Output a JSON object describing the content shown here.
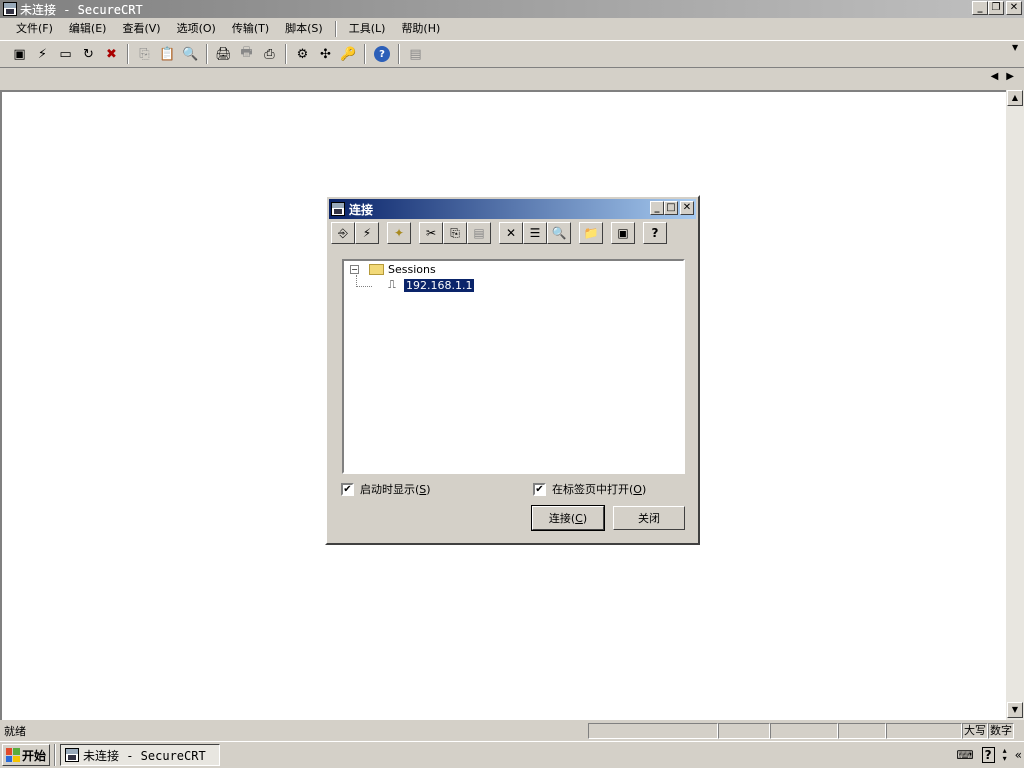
{
  "window": {
    "title": "未连接 - SecureCRT",
    "minimize": "_",
    "restore": "❐",
    "close": "✕"
  },
  "menu": [
    "文件(F)",
    "编辑(E)",
    "查看(V)",
    "选项(O)",
    "传输(T)",
    "脚本(S)",
    "工具(L)",
    "帮助(H)"
  ],
  "toolbar_icons": [
    {
      "name": "connect-icon",
      "glyph": "▣"
    },
    {
      "name": "quick-connect-icon",
      "glyph": "⚡"
    },
    {
      "name": "connect-tab-icon",
      "glyph": "▭"
    },
    {
      "name": "reconnect-icon",
      "glyph": "↻"
    },
    {
      "name": "disconnect-icon",
      "glyph": "✖"
    },
    {
      "name": "copy-icon",
      "glyph": "⎘"
    },
    {
      "name": "paste-icon",
      "glyph": "📋"
    },
    {
      "name": "find-icon",
      "glyph": "🔍"
    },
    {
      "name": "print-icon",
      "glyph": "🖨"
    },
    {
      "name": "print-selection-icon",
      "glyph": "🖶"
    },
    {
      "name": "print-setup-icon",
      "glyph": "⎙"
    },
    {
      "name": "session-options-icon",
      "glyph": "⚙"
    },
    {
      "name": "global-options-icon",
      "glyph": "✣"
    },
    {
      "name": "keymap-icon",
      "glyph": "🔑"
    },
    {
      "name": "help-icon",
      "glyph": "?"
    },
    {
      "name": "log-icon",
      "glyph": "▤"
    }
  ],
  "status": {
    "text": "就绪",
    "caps": "大写",
    "num": "数字"
  },
  "taskbar": {
    "start": "开始",
    "task": "未连接 - SecureCRT"
  },
  "dialog": {
    "title": "连接",
    "toolbar_icons": [
      {
        "name": "dlg-quick-connect-icon",
        "glyph": "⎆"
      },
      {
        "name": "dlg-connect-icon",
        "glyph": "⚡"
      },
      {
        "name": "dlg-new-session-icon",
        "glyph": "✦"
      },
      {
        "name": "dlg-cut-icon",
        "glyph": "✂"
      },
      {
        "name": "dlg-copy-icon",
        "glyph": "⎘"
      },
      {
        "name": "dlg-paste-icon",
        "glyph": "▤"
      },
      {
        "name": "dlg-delete-icon",
        "glyph": "✕"
      },
      {
        "name": "dlg-properties-icon",
        "glyph": "☰"
      },
      {
        "name": "dlg-find-icon",
        "glyph": "🔍"
      },
      {
        "name": "dlg-new-folder-icon",
        "glyph": "📁"
      },
      {
        "name": "dlg-desktop-icon",
        "glyph": "▣"
      },
      {
        "name": "dlg-help-icon",
        "glyph": "?"
      }
    ],
    "tree": {
      "root_label": "Sessions",
      "expander": "−",
      "child_label": "192.168.1.1"
    },
    "show_on_startup": {
      "label": "启动时显示(",
      "accel": "S",
      "tail": ")",
      "checked": "✔"
    },
    "open_in_tab": {
      "label": "在标签页中打开(",
      "accel": "O",
      "tail": ")",
      "checked": "✔"
    },
    "connect_button": {
      "label": "连接(",
      "accel": "C",
      "tail": ")"
    },
    "close_button": "关闭"
  }
}
